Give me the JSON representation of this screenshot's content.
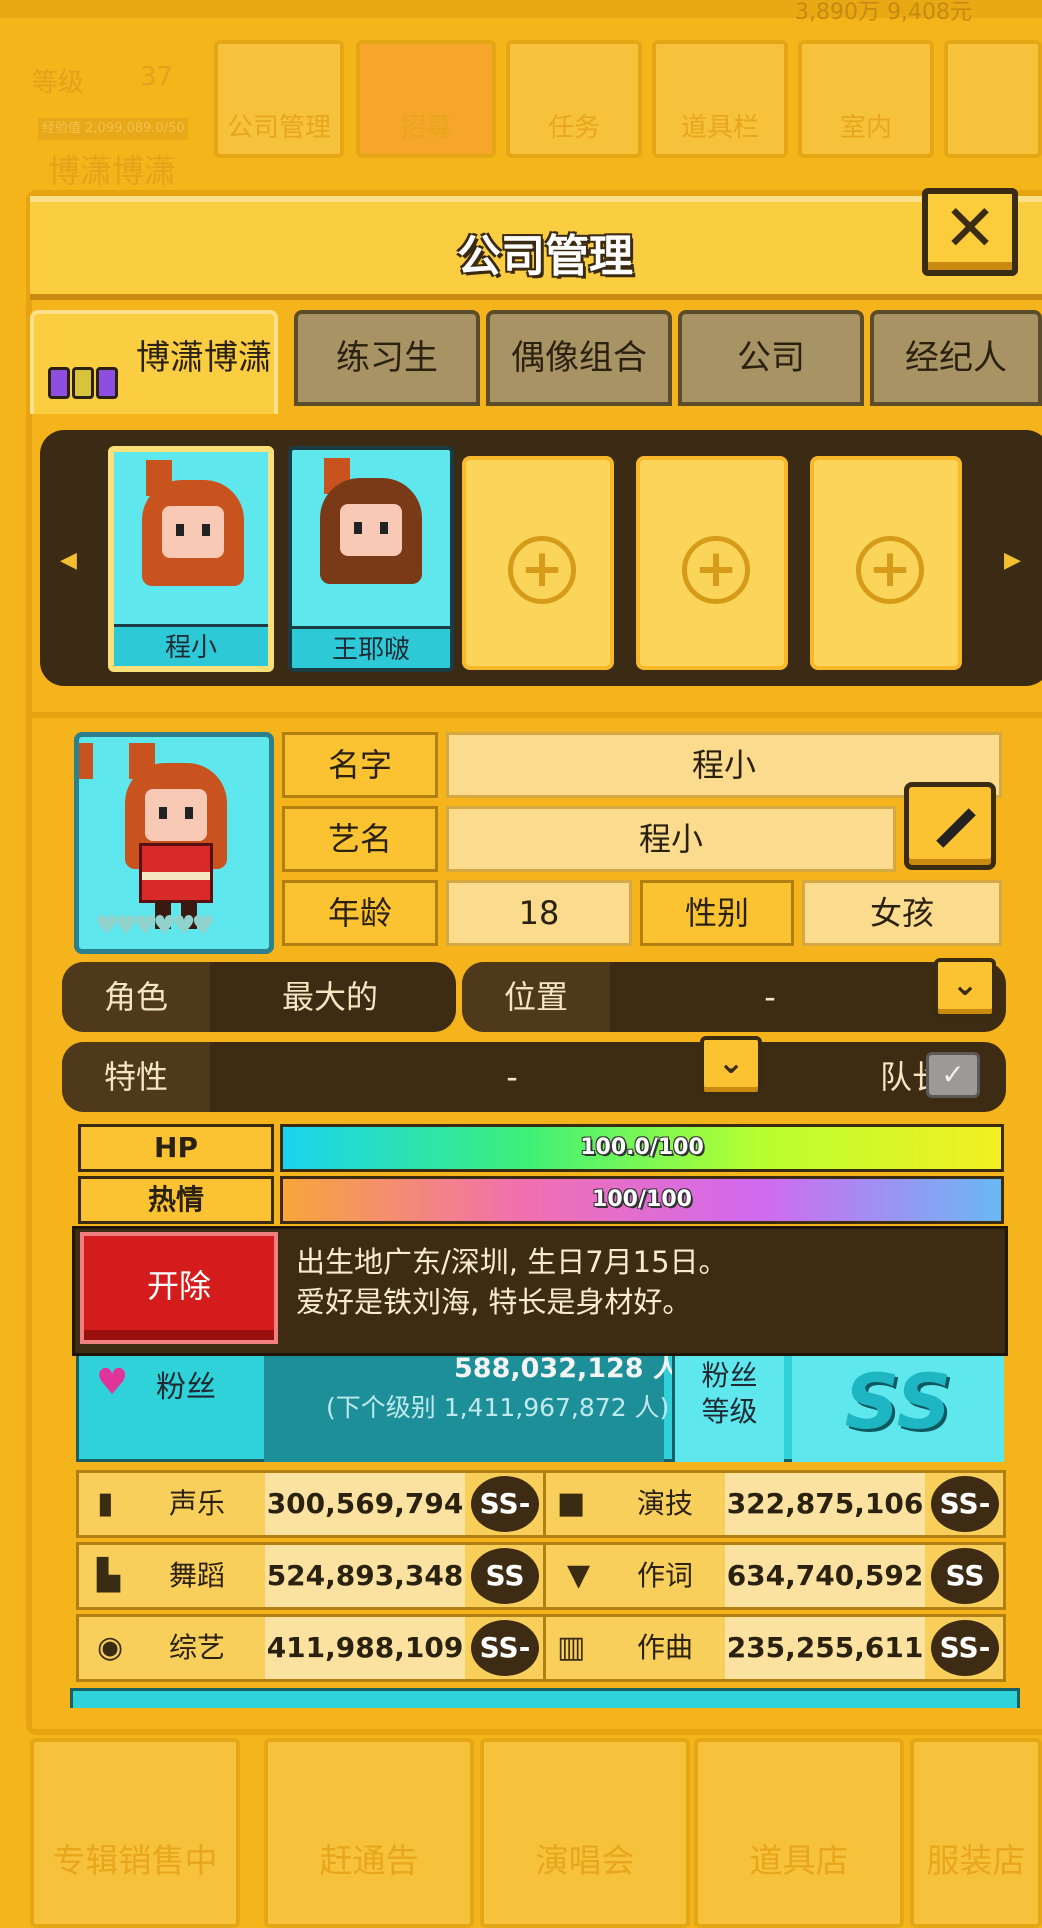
{
  "background": {
    "money": "3,890万 9,408元",
    "level_label": "等级",
    "level_value": "37",
    "exp_text": "经验值 2,099,089.0/50",
    "player_name": "博潇博潇",
    "menu": [
      "公司管理",
      "招募",
      "任务",
      "道具栏",
      "室内"
    ],
    "bottom_menu": [
      "专辑销售中",
      "赶通告",
      "演唱会",
      "道具店",
      "服装店"
    ]
  },
  "modal": {
    "title": "公司管理",
    "close_symbol": "✕"
  },
  "tabs": [
    {
      "label": "博潇博潇",
      "active": true
    },
    {
      "label": "练习生",
      "active": false
    },
    {
      "label": "偶像组合",
      "active": false
    },
    {
      "label": "公司",
      "active": false
    },
    {
      "label": "经纪人",
      "active": false
    }
  ],
  "members": [
    {
      "name": "程小",
      "selected": true
    },
    {
      "name": "王耶啵",
      "selected": false
    }
  ],
  "slot_symbol": "+",
  "profile": {
    "name_label": "名字",
    "name_value": "程小",
    "stage_label": "艺名",
    "stage_value": "程小",
    "age_label": "年龄",
    "age_value": "18",
    "gender_label": "性别",
    "gender_value": "女孩",
    "hearts": "♥♥♥♥♥♥"
  },
  "role": {
    "role_label": "角色",
    "role_value": "最大的",
    "position_label": "位置",
    "position_value": "-",
    "trait_label": "特性",
    "trait_value": "-",
    "leader_label": "队长"
  },
  "bars": {
    "hp_label": "HP",
    "hp_text": "100.0/100",
    "hp_fraction": 1.0,
    "passion_label": "热情",
    "passion_text": "100/100",
    "passion_fraction": 1.0
  },
  "bio": {
    "fire_label": "开除",
    "line1": "出生地广东/深圳, 生日7月15日。",
    "line2": "爱好是铁刘海, 特长是身材好。"
  },
  "fans": {
    "label": "粉丝",
    "count": "588,032,128 人",
    "next": "(下个级别 1,411,967,872 人)",
    "grade_label_1": "粉丝",
    "grade_label_2": "等级",
    "grade": "SS"
  },
  "stats": [
    {
      "name": "声乐",
      "value": "300,569,794",
      "grade": "SS-"
    },
    {
      "name": "演技",
      "value": "322,875,106",
      "grade": "SS-"
    },
    {
      "name": "舞蹈",
      "value": "524,893,348",
      "grade": "SS"
    },
    {
      "name": "作词",
      "value": "634,740,592",
      "grade": "SS"
    },
    {
      "name": "综艺",
      "value": "411,988,109",
      "grade": "SS-"
    },
    {
      "name": "作曲",
      "value": "235,255,611",
      "grade": "SS-"
    }
  ],
  "colors": {
    "panel": "#f6b41c",
    "accent_cyan": "#5ee8ee",
    "dark_brown": "#3d2c13",
    "fire_red": "#d51c1c"
  }
}
